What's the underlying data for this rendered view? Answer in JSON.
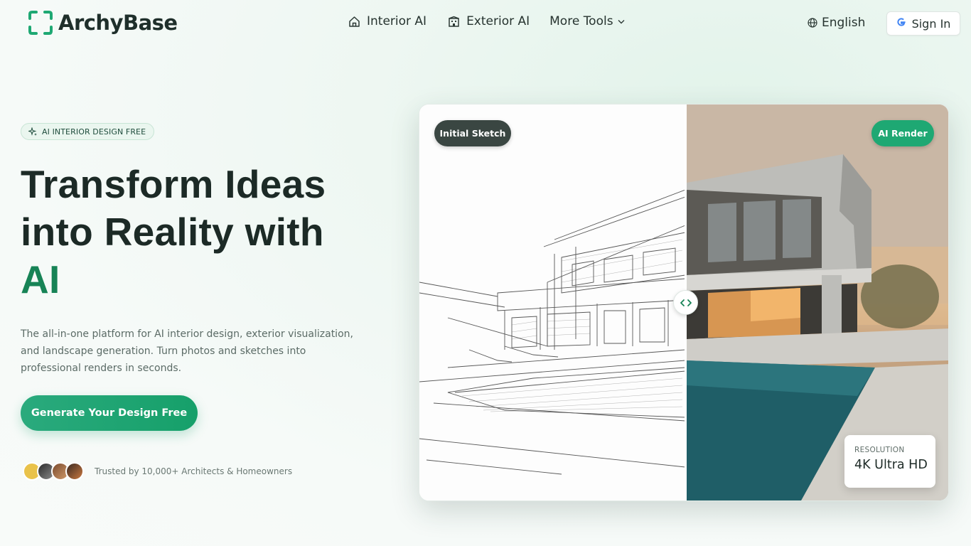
{
  "brand": {
    "name": "ArchyBase",
    "accent": "#178356",
    "accent_light": "#1ea873"
  },
  "nav": {
    "items": [
      {
        "label": "Interior AI",
        "icon": "home-icon"
      },
      {
        "label": "Exterior AI",
        "icon": "building-icon"
      },
      {
        "label": "More Tools",
        "icon": "chevron-down-icon"
      }
    ],
    "language": "English",
    "signin": "Sign In"
  },
  "hero": {
    "badge": "AI INTERIOR DESIGN FREE",
    "headline_line1": "Transform Ideas",
    "headline_line2": "into Reality with",
    "headline_accent": "AI",
    "description": "The all-in-one platform for AI interior design, exterior visualization, and landscape generation. Turn photos and sketches into professional renders in seconds.",
    "cta": "Generate Your Design Free",
    "trust_text": "Trusted by 10,000+ Architects & Homeowners"
  },
  "comparison": {
    "left_label": "Initial Sketch",
    "right_label": "AI Render",
    "resolution_label": "RESOLUTION",
    "resolution_value": "4K Ultra HD"
  }
}
